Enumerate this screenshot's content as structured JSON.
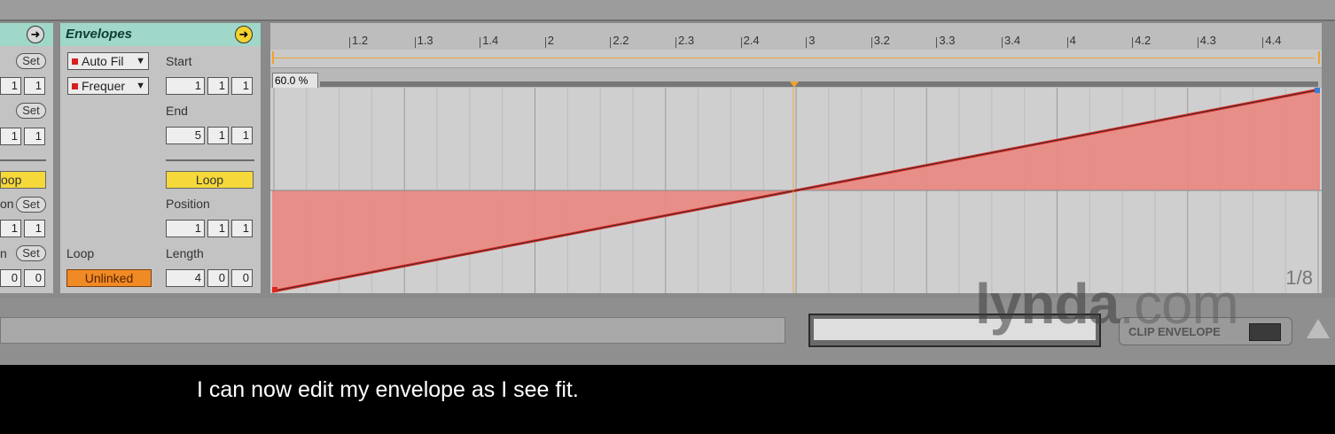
{
  "left_panel": {
    "set_labels": [
      "Set",
      "Set",
      "Set",
      "Set"
    ],
    "row_values": [
      [
        "1",
        "1"
      ],
      [
        "1",
        "1"
      ],
      [
        "1",
        "1"
      ],
      [
        "0",
        "0"
      ]
    ],
    "loop_button": "oop",
    "partial_label_1": "on",
    "partial_label_2": "n"
  },
  "envelopes_panel": {
    "title": "Envelopes",
    "device_dropdown": "Auto Fil",
    "control_dropdown": "Frequer",
    "loop_label": "Loop",
    "unlinked_button": "Unlinked",
    "start_label": "Start",
    "start_values": [
      "1",
      "1",
      "1"
    ],
    "end_label": "End",
    "end_values": [
      "5",
      "1",
      "1"
    ],
    "loop_button": "Loop",
    "position_label": "Position",
    "position_values": [
      "1",
      "1",
      "1"
    ],
    "length_label": "Length",
    "length_values": [
      "4",
      "0",
      "0"
    ],
    "dropdown_arrow": "▼"
  },
  "editor": {
    "ruler_labels": [
      "1.2",
      "1.3",
      "1.4",
      "2",
      "2.2",
      "2.3",
      "2.4",
      "3",
      "3.2",
      "3.3",
      "3.4",
      "4",
      "4.2",
      "4.3",
      "4.4"
    ],
    "value_readout": "60.0 %",
    "grid_label": "1/8",
    "envelope_start_fraction": 0.0,
    "envelope_end_fraction": 1.0,
    "center_fraction": 0.5,
    "colors": {
      "fill": "#e88a85",
      "line": "#e0251f",
      "grid_bg": "#cfcfcf",
      "marker": "#f0a030"
    }
  },
  "bottom_bar": {
    "clip_envelope_label": "CLIP ENVELOPE"
  },
  "watermark": {
    "brand": "lynda",
    "suffix": ".com"
  },
  "caption": {
    "text": "I can now edit my envelope as I see fit."
  }
}
